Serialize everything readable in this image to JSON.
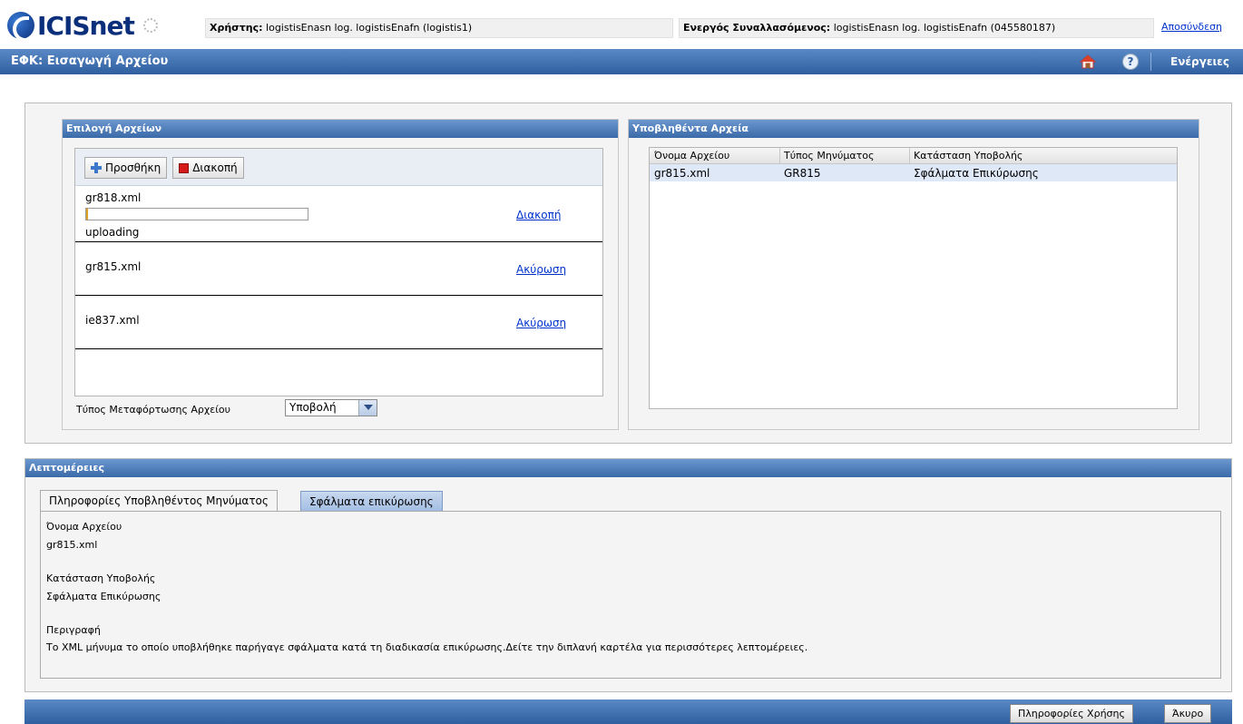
{
  "header": {
    "logo_text": "ICISnet",
    "user_label": "Χρήστης:",
    "user_value": "logistisEnasn log. logistisEnafn (logistis1)",
    "trader_label": "Ενεργός Συναλλασόμενος:",
    "trader_value": "logistisEnasn log. logistisEnafn (045580187)",
    "logout": "Αποσύνδεση"
  },
  "titlebar": {
    "title": "ΕΦΚ: Εισαγωγή Αρχείου",
    "actions": "Ενέργειες"
  },
  "file_selection": {
    "title": "Επιλογή Αρχείων",
    "add_button": "Προσθήκη",
    "stop_button": "Διακοπή",
    "files": [
      {
        "name": "gr818.xml",
        "status": "uploading",
        "action": "Διακοπή",
        "progress": 0.01
      },
      {
        "name": "gr815.xml",
        "action": "Ακύρωση"
      },
      {
        "name": "ie837.xml",
        "action": "Ακύρωση"
      }
    ],
    "transfer_type_label": "Τύπος Μεταφόρτωσης Αρχείου",
    "transfer_type_value": "Υποβολή"
  },
  "submitted_files": {
    "title": "Υποβληθέντα Αρχεία",
    "columns": [
      "Όνομα Αρχείου",
      "Τύπος Μηνύματος",
      "Κατάσταση Υποβολής"
    ],
    "rows": [
      [
        "gr815.xml",
        "GR815",
        "Σφάλματα Επικύρωσης"
      ]
    ]
  },
  "details": {
    "title": "Λεπτομέρειες",
    "tabs": [
      "Πληροφορίες Υποβληθέντος Μηνύματος",
      "Σφάλματα επικύρωσης"
    ],
    "filename_label": "Όνομα Αρχείου",
    "filename_value": "gr815.xml",
    "status_label": "Κατάσταση Υποβολής",
    "status_value": "Σφάλματα Επικύρωσης",
    "description_label": "Περιγραφή",
    "description_value": "Το XML μήνυμα το οποίο υποβλήθηκε παρήγαγε σφάλματα κατά τη διαδικασία επικύρωσης.Δείτε την διπλανή καρτέλα για περισσότερες λεπτομέρειες."
  },
  "footer": {
    "help_button": "Πληροφορίες Χρήσης",
    "cancel_button": "Άκυρο"
  },
  "icons": [
    "logo-icon",
    "spinner-icon",
    "home-icon",
    "help-icon",
    "plus-icon",
    "stop-icon",
    "dropdown-arrow-icon"
  ],
  "colors": {
    "title_blue": "#2f5f9f",
    "link": "#0033cc",
    "progress": "#e0a020",
    "selected_row": "#dfe8f6"
  }
}
